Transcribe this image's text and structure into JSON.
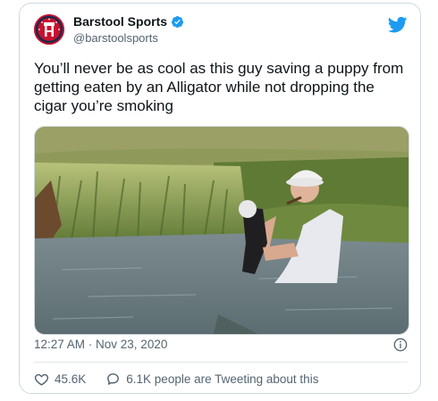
{
  "author": {
    "display_name": "Barstool Sports",
    "handle": "@barstoolsports",
    "verified": true,
    "avatar_icon": "barstool-logo-icon"
  },
  "tweet": {
    "text": "You’ll never be as cool as this guy saving a puppy from getting eaten by an Alligator while not dropping the cigar you’re smoking",
    "timestamp": "12:27 AM · Nov 23, 2020"
  },
  "engagement": {
    "likes": "45.6K",
    "conversation_label": "6.1K people are Tweeting about this"
  },
  "colors": {
    "brand_red": "#c8102e",
    "twitter_blue": "#1d9bf0",
    "text_primary": "#0f1419",
    "text_secondary": "#536471"
  }
}
